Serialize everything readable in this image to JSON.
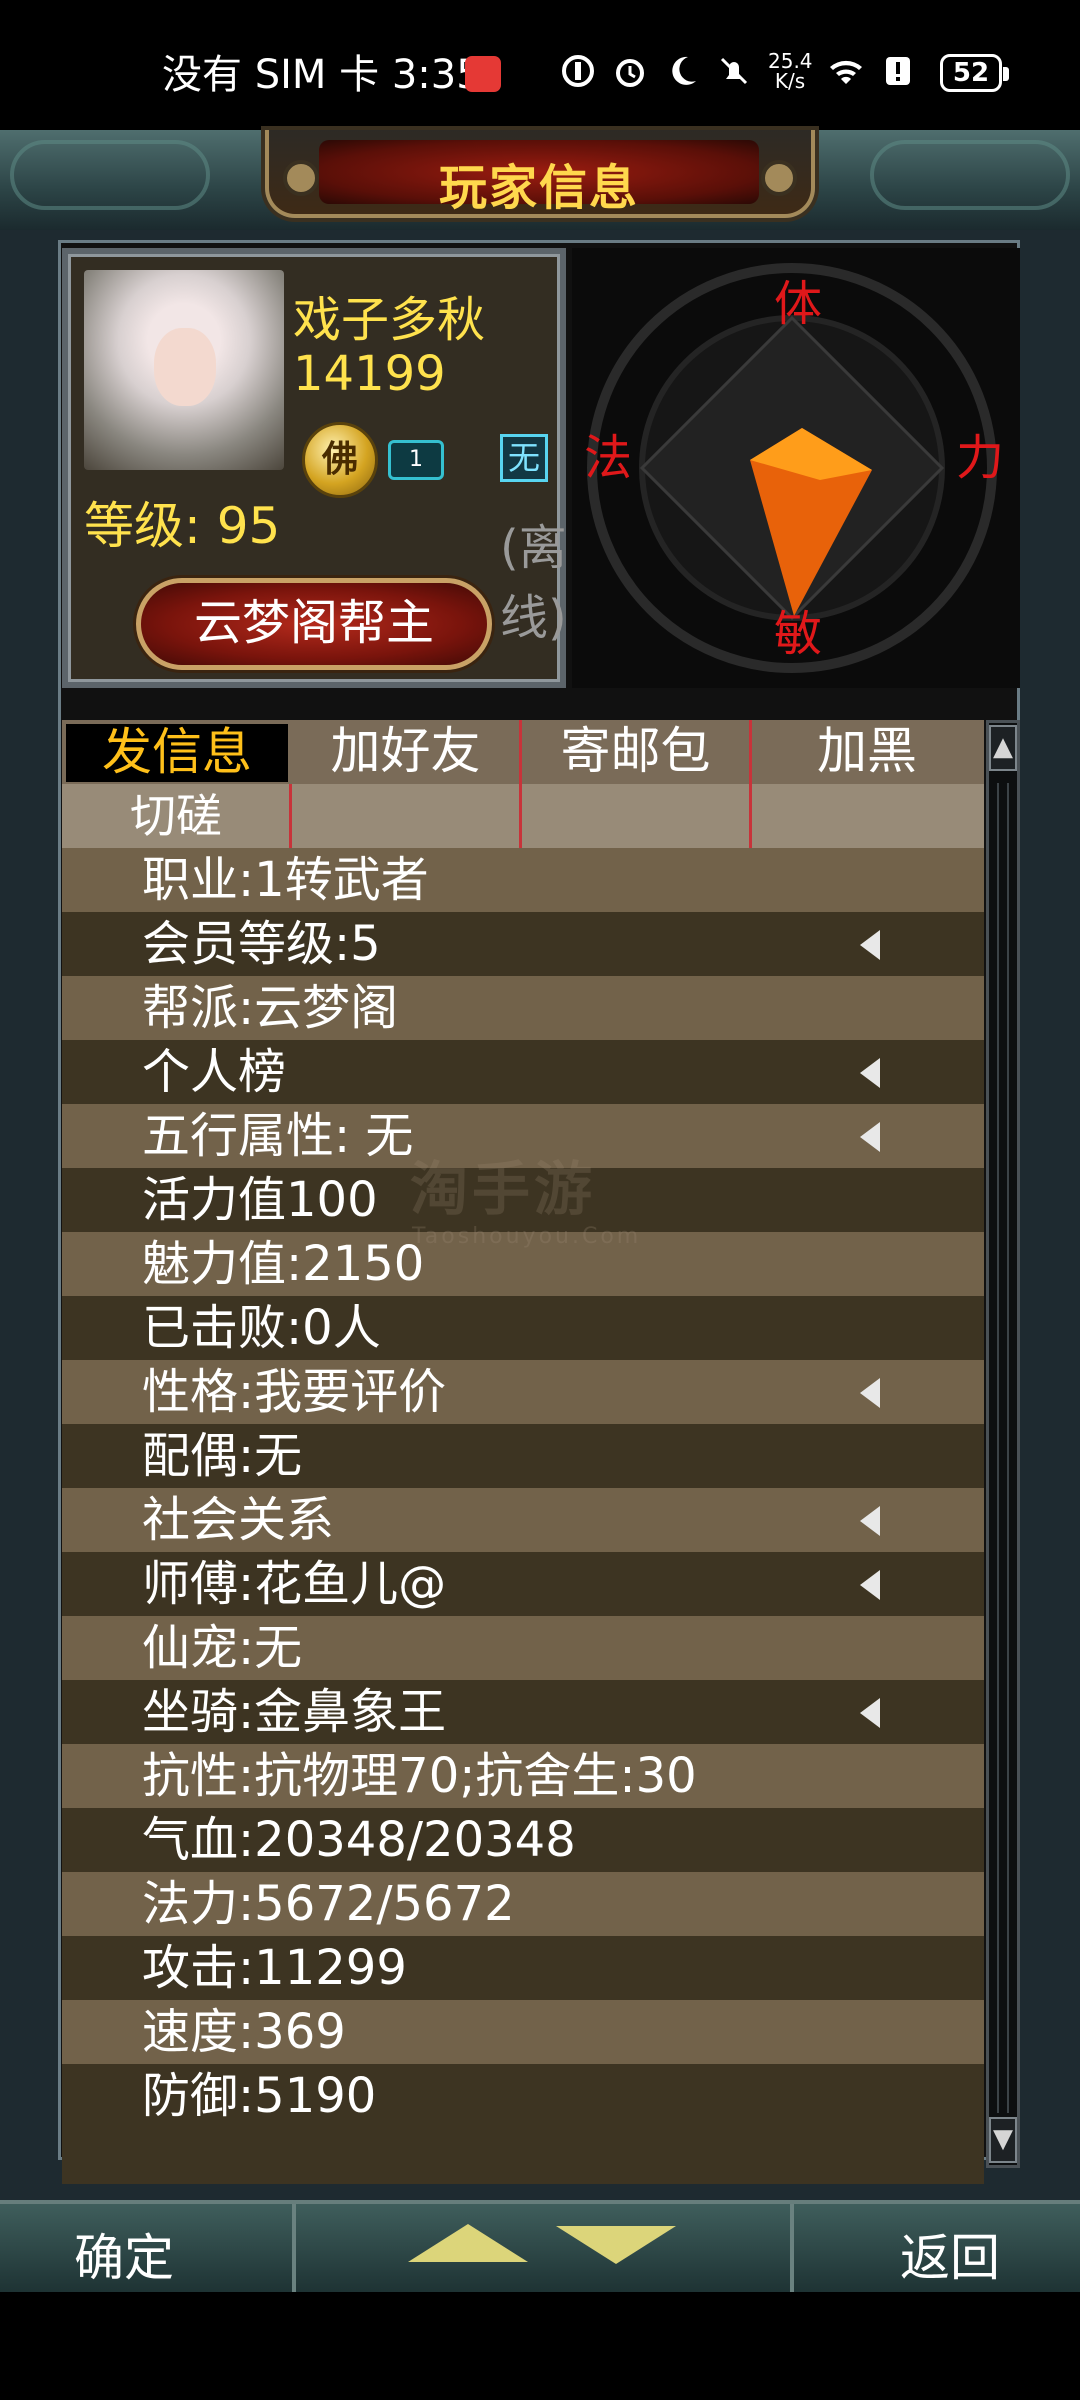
{
  "status_bar": {
    "carrier": "没有 SIM 卡",
    "time": "3:35",
    "net_speed_value": "25.4",
    "net_speed_unit": "K/s",
    "battery": "52"
  },
  "header": {
    "title": "玩家信息"
  },
  "profile": {
    "name": "戏子多秋",
    "id": "14199",
    "level": "等级: 95",
    "faith_badge": "佛",
    "vip_badge": "1",
    "element_badge": "无",
    "status": "(离线)",
    "guild_title": "云梦阁帮主"
  },
  "attributes": {
    "top": "体",
    "left": "法",
    "right": "力",
    "bottom": "敏",
    "colors": {
      "label": "#e0181a",
      "kite_light": "#ff9d1a",
      "kite_dark": "#e8620a"
    }
  },
  "tabs": {
    "row1": [
      "发信息",
      "加好友",
      "寄邮包",
      "加黑"
    ],
    "row2": [
      "切磋",
      "",
      "",
      ""
    ]
  },
  "info_rows": [
    {
      "text": "职业:1转武者",
      "arrow": false
    },
    {
      "text": "会员等级:5",
      "arrow": true
    },
    {
      "text": "帮派:云梦阁",
      "arrow": false
    },
    {
      "text": "个人榜",
      "arrow": true
    },
    {
      "text": "五行属性: 无",
      "arrow": true
    },
    {
      "text": "活力值100",
      "arrow": false
    },
    {
      "text": "魅力值:2150",
      "arrow": false
    },
    {
      "text": "已击败:0人",
      "arrow": false
    },
    {
      "text": "性格:我要评价",
      "arrow": true
    },
    {
      "text": "配偶:无",
      "arrow": false
    },
    {
      "text": "社会关系",
      "arrow": true
    },
    {
      "text": "师傅:花鱼儿@",
      "arrow": true
    },
    {
      "text": "仙宠:无",
      "arrow": false
    },
    {
      "text": "坐骑:金鼻象王",
      "arrow": true
    },
    {
      "text": "抗性:抗物理70;抗舍生:30",
      "arrow": false
    },
    {
      "text": "气血:20348/20348",
      "arrow": false
    },
    {
      "text": "法力:5672/5672",
      "arrow": false
    },
    {
      "text": "攻击:11299",
      "arrow": false
    },
    {
      "text": "速度:369",
      "arrow": false
    },
    {
      "text": "防御:5190",
      "arrow": false
    }
  ],
  "watermark": {
    "main": "淘手游",
    "sub": "Taoshouyou.Com"
  },
  "bottom_bar": {
    "confirm": "确定",
    "back": "返回"
  },
  "icons": {
    "scroll_up": "up-arrow-icon",
    "scroll_down": "down-arrow-icon",
    "row_arrow": "left-triangle-icon",
    "page_up": "triangle-up-icon",
    "page_down": "triangle-down-icon"
  }
}
